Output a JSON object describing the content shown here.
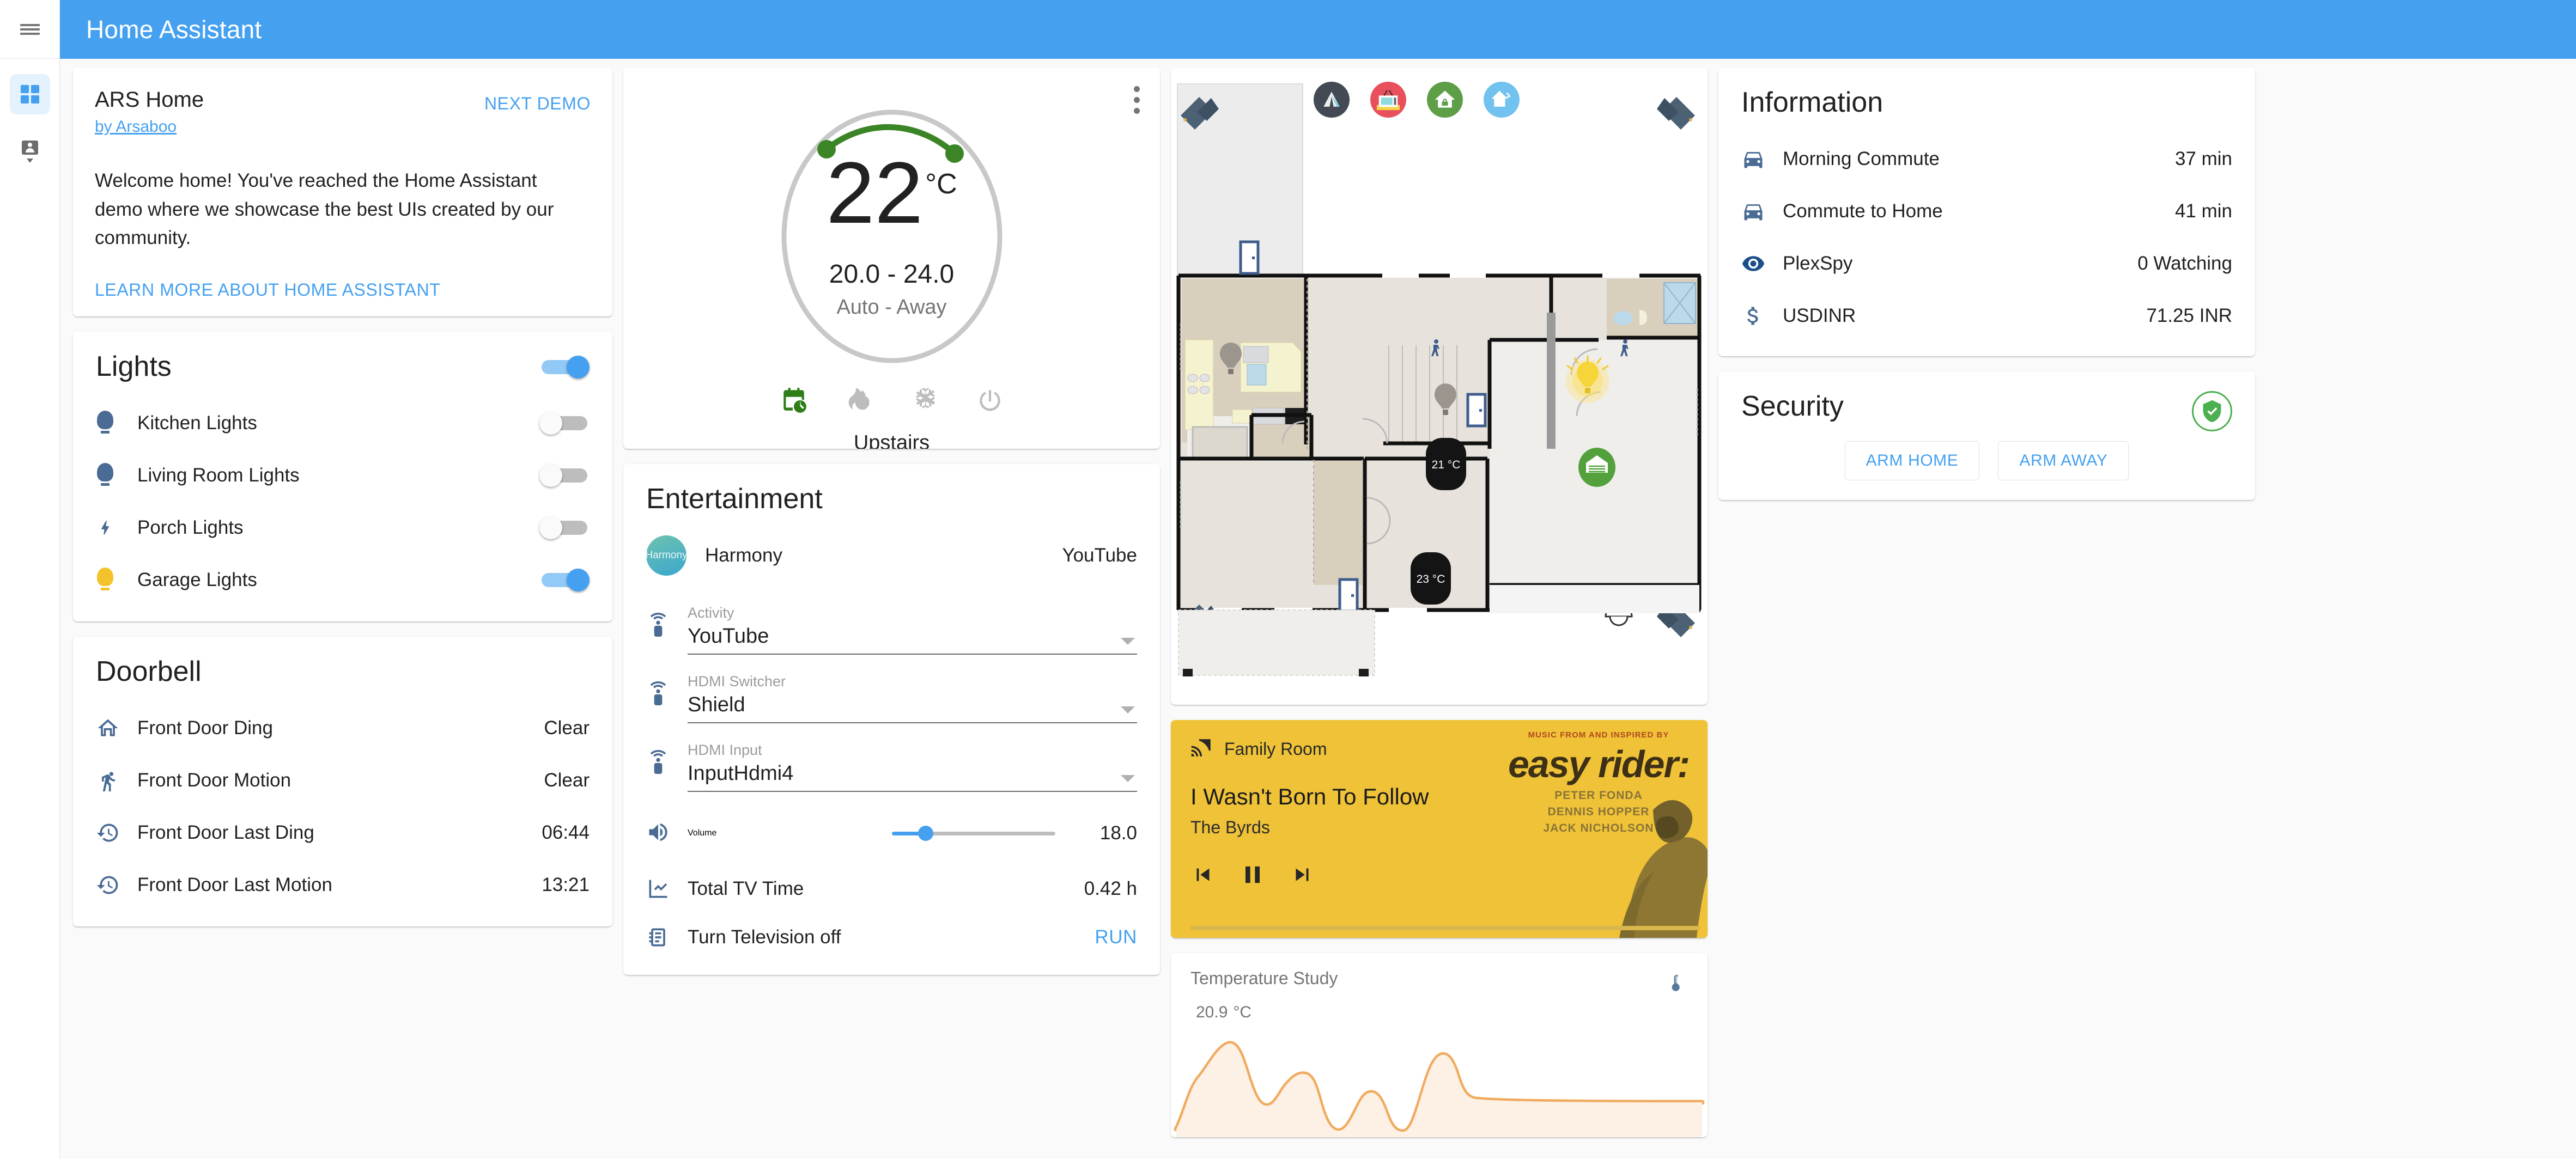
{
  "app": {
    "title": "Home Assistant"
  },
  "sidebar": {
    "menu_icon": "hamburger-menu-icon",
    "items": [
      {
        "icon": "dashboard-grid-icon",
        "active": true
      },
      {
        "icon": "person-marker-icon",
        "active": false
      }
    ]
  },
  "demo": {
    "name": "ARS Home",
    "author": "by Arsaboo",
    "next_demo": "NEXT DEMO",
    "body": "Welcome home! You've reached the Home Assistant demo where we showcase the best UIs created by our community.",
    "learn_more": "LEARN MORE ABOUT HOME ASSISTANT"
  },
  "lights": {
    "title": "Lights",
    "master_on": true,
    "items": [
      {
        "icon": "lightbulb-icon",
        "label": "Kitchen Lights",
        "on": false,
        "color": "#4a6b94"
      },
      {
        "icon": "lightbulb-icon",
        "label": "Living Room Lights",
        "on": false,
        "color": "#4a6b94"
      },
      {
        "icon": "flash-icon",
        "label": "Porch Lights",
        "on": false,
        "color": "#4a6b94"
      },
      {
        "icon": "lightbulb-icon",
        "label": "Garage Lights",
        "on": true,
        "color": "#f3c32c"
      }
    ]
  },
  "doorbell": {
    "title": "Doorbell",
    "items": [
      {
        "icon": "home-outline-icon",
        "label": "Front Door Ding",
        "value": "Clear"
      },
      {
        "icon": "walk-icon",
        "label": "Front Door Motion",
        "value": "Clear"
      },
      {
        "icon": "history-clock-icon",
        "label": "Front Door Last Ding",
        "value": "06:44"
      },
      {
        "icon": "history-clock-icon",
        "label": "Front Door Last Motion",
        "value": "13:21"
      }
    ]
  },
  "thermostat": {
    "menu_icon": "more-vertical-icon",
    "current_temp": "22",
    "unit": "°C",
    "target_range": "20.0 - 24.0",
    "mode_text": "Auto - Away",
    "name": "Upstairs",
    "arc_color": "#3c8527",
    "modes": [
      {
        "icon": "calendar-sync-icon",
        "active": true
      },
      {
        "icon": "fire-icon",
        "active": false
      },
      {
        "icon": "snowflake-icon",
        "active": false
      },
      {
        "icon": "power-icon",
        "active": false
      }
    ]
  },
  "entertainment": {
    "title": "Entertainment",
    "media": {
      "avatar_label": "Harmony",
      "name": "Harmony",
      "state": "YouTube"
    },
    "selects": [
      {
        "icon": "remote-icon",
        "label": "Activity",
        "value": "YouTube"
      },
      {
        "icon": "remote-icon",
        "label": "HDMI Switcher",
        "value": "Shield"
      },
      {
        "icon": "remote-icon",
        "label": "HDMI Input",
        "value": "InputHdmi4"
      }
    ],
    "volume": {
      "icon": "volume-icon",
      "label": "Volume",
      "value": "18.0",
      "percent": 20
    },
    "tv_time": {
      "icon": "chart-line-icon",
      "label": "Total TV Time",
      "value": "0.42 h"
    },
    "script": {
      "icon": "script-icon",
      "label": "Turn Television off",
      "action": "RUN"
    }
  },
  "floorplan": {
    "top_icons": [
      {
        "name": "tent-logo-icon",
        "bg": "#434a54"
      },
      {
        "name": "television-icon",
        "bg": "#e8505b"
      },
      {
        "name": "house-unlock-icon",
        "bg": "#5d9e47"
      },
      {
        "name": "house-wifi-icon",
        "bg": "#72c2ef"
      }
    ],
    "thermostats": [
      {
        "label": "21 °C"
      },
      {
        "label": "23 °C"
      }
    ],
    "garage_icon": "garage-open-icon",
    "lights_on": 1,
    "lights_off": 3,
    "cameras": 4,
    "motion_sensors": 3,
    "door_sensors": 3
  },
  "media_player": {
    "source_icon": "cast-icon",
    "source": "Family Room",
    "title": "I Wasn't Born To Follow",
    "artist": "The Byrds",
    "bg_color": "#efc238",
    "controls": [
      {
        "icon": "skip-previous-icon"
      },
      {
        "icon": "pause-icon"
      },
      {
        "icon": "skip-next-icon"
      }
    ],
    "album_art": {
      "overline": "MUSIC FROM AND INSPIRED BY",
      "title": "easy rider:",
      "cast": [
        "PETER FONDA",
        "DENNIS HOPPER",
        "JACK NICHOLSON"
      ]
    }
  },
  "temperature_study": {
    "title": "Temperature Study",
    "value": "20.9",
    "unit": "°C",
    "icon": "thermometer-icon",
    "line_color": "#f0ab5f",
    "fill_color": "#fdf0e4"
  },
  "information": {
    "title": "Information",
    "items": [
      {
        "icon": "car-icon",
        "label": "Morning Commute",
        "value": "37 min"
      },
      {
        "icon": "car-icon",
        "label": "Commute to Home",
        "value": "41 min"
      },
      {
        "icon": "eye-icon",
        "label": "PlexSpy",
        "value": "0 Watching"
      },
      {
        "icon": "dollar-icon",
        "label": "USDINR",
        "value": "71.25 INR"
      }
    ]
  },
  "security": {
    "title": "Security",
    "status_icon": "shield-check-icon",
    "status_color": "#4caf50",
    "buttons": [
      {
        "label": "ARM HOME"
      },
      {
        "label": "ARM AWAY"
      }
    ]
  },
  "chart_data": {
    "type": "area",
    "title": "Temperature Study",
    "ylabel": "°C",
    "x": [
      0,
      1,
      2,
      3,
      4,
      5,
      6,
      7,
      8,
      9,
      10,
      11,
      12,
      13,
      14,
      15,
      16,
      17,
      18,
      19,
      20,
      21,
      22,
      23
    ],
    "values": [
      19.4,
      20.6,
      22.3,
      22.6,
      21.2,
      20.9,
      21.5,
      21.8,
      20.4,
      19.6,
      19.3,
      20.2,
      20.9,
      20.1,
      19.4,
      21.0,
      22.2,
      21.4,
      21.0,
      20.9,
      20.9,
      20.9,
      20.9,
      20.9
    ],
    "ylim": [
      19.0,
      23.0
    ],
    "grid": false,
    "legend": false
  }
}
